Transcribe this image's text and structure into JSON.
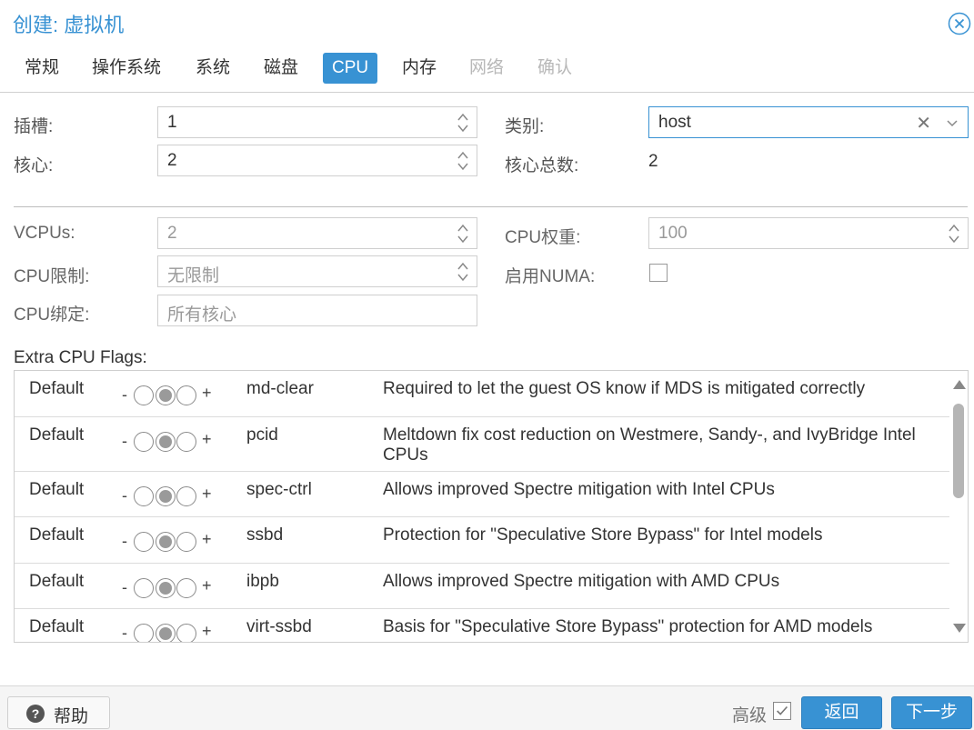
{
  "window": {
    "title": "创建: 虚拟机"
  },
  "tabs": [
    {
      "label": "常规",
      "state": "normal"
    },
    {
      "label": "操作系统",
      "state": "normal"
    },
    {
      "label": "系统",
      "state": "normal"
    },
    {
      "label": "磁盘",
      "state": "normal"
    },
    {
      "label": "CPU",
      "state": "active"
    },
    {
      "label": "内存",
      "state": "normal"
    },
    {
      "label": "网络",
      "state": "disabled"
    },
    {
      "label": "确认",
      "state": "disabled"
    }
  ],
  "form": {
    "sockets": {
      "label": "插槽:",
      "value": "1"
    },
    "cores": {
      "label": "核心:",
      "value": "2"
    },
    "type": {
      "label": "类别:",
      "value": "host"
    },
    "total_cores": {
      "label": "核心总数:",
      "value": "2"
    },
    "vcpus": {
      "label": "VCPUs:",
      "value": "2"
    },
    "cpu_limit": {
      "label": "CPU限制:",
      "placeholder": "无限制"
    },
    "cpu_affinity": {
      "label": "CPU绑定:",
      "placeholder": "所有核心"
    },
    "cpu_units": {
      "label": "CPU权重:",
      "value": "100"
    },
    "numa": {
      "label": "启用NUMA:",
      "checked": false
    }
  },
  "flags": {
    "label": "Extra CPU Flags:",
    "minus": "-",
    "plus": "+",
    "rows": [
      {
        "state": "Default",
        "flag": "md-clear",
        "description": "Required to let the guest OS know if MDS is mitigated correctly"
      },
      {
        "state": "Default",
        "flag": "pcid",
        "description": "Meltdown fix cost reduction on Westmere, Sandy-, and IvyBridge Intel CPUs"
      },
      {
        "state": "Default",
        "flag": "spec-ctrl",
        "description": "Allows improved Spectre mitigation with Intel CPUs"
      },
      {
        "state": "Default",
        "flag": "ssbd",
        "description": "Protection for \"Speculative Store Bypass\" for Intel models"
      },
      {
        "state": "Default",
        "flag": "ibpb",
        "description": "Allows improved Spectre mitigation with AMD CPUs"
      },
      {
        "state": "Default",
        "flag": "virt-ssbd",
        "description": "Basis for \"Speculative Store Bypass\" protection for AMD models"
      }
    ]
  },
  "footer": {
    "help": "帮助",
    "advanced": "高级",
    "advanced_checked": true,
    "back": "返回",
    "next": "下一步"
  },
  "colors": {
    "accent": "#3892d3",
    "disabled_text": "#b8b8b8"
  }
}
